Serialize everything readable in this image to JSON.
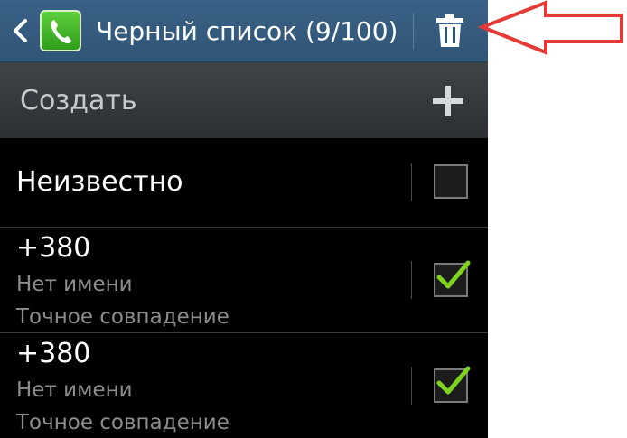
{
  "action_bar": {
    "title": "Черный список (9/100)",
    "back_icon": "chevron-left-icon",
    "app_icon": "phone-icon",
    "delete_icon": "trash-icon"
  },
  "create_row": {
    "label": "Создать",
    "icon": "plus-icon"
  },
  "list": [
    {
      "number": "Неизвестно",
      "checked": false
    },
    {
      "number": "+380",
      "name": "Нет имени",
      "match": "Точное совпадение",
      "checked": true
    },
    {
      "number": "+380",
      "name": "Нет имени",
      "match": "Точное совпадение",
      "checked": true
    }
  ],
  "colors": {
    "action_bar": "#2f5577",
    "check": "#7ed321",
    "annotation": "#e53935"
  }
}
